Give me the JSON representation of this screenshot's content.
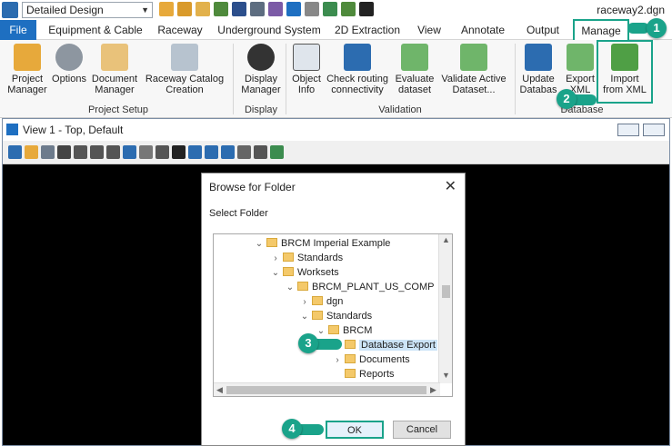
{
  "title_bar": {
    "workspace_select": "Detailed Design",
    "document_title": "raceway2.dgn"
  },
  "tabs": [
    {
      "label": "File"
    },
    {
      "label": "Equipment & Cable"
    },
    {
      "label": "Raceway"
    },
    {
      "label": "Underground System"
    },
    {
      "label": "2D Extraction"
    },
    {
      "label": "View"
    },
    {
      "label": "Annotate"
    },
    {
      "label": "Output"
    },
    {
      "label": "Manage"
    }
  ],
  "ribbon": {
    "project_setup": {
      "label": "Project Setup",
      "project_manager": "Project Manager",
      "options": "Options",
      "document_manager": "Document Manager",
      "raceway_catalog": "Raceway Catalog Creation"
    },
    "display": {
      "label": "Display",
      "display_manager": "Display Manager"
    },
    "validation": {
      "label": "Validation",
      "object_info": "Object Info",
      "check_routing": "Check routing connectivity",
      "evaluate_dataset": "Evaluate dataset",
      "validate_active": "Validate Active Dataset..."
    },
    "database": {
      "label": "Database",
      "update_database": "Update Databas",
      "export_xml": "Export XML",
      "import_xml": "Import from XML"
    }
  },
  "view_window": {
    "title": "View 1 - Top, Default"
  },
  "dialog": {
    "title": "Browse for Folder",
    "subtitle": "Select Folder",
    "tree": [
      {
        "label": "BRCM Imperial Example",
        "expander": "⌄"
      },
      {
        "label": "Standards",
        "expander": "›"
      },
      {
        "label": "Worksets",
        "expander": "⌄"
      },
      {
        "label": "BRCM_PLANT_US_COMP",
        "expander": "⌄"
      },
      {
        "label": "dgn",
        "expander": "›"
      },
      {
        "label": "Standards",
        "expander": "⌄"
      },
      {
        "label": "BRCM",
        "expander": "⌄"
      },
      {
        "label": "Database Export",
        "expander": ""
      },
      {
        "label": "Documents",
        "expander": "›"
      },
      {
        "label": "Reports",
        "expander": ""
      }
    ],
    "ok": "OK",
    "cancel": "Cancel"
  },
  "callouts": [
    "1",
    "2",
    "3",
    "4"
  ],
  "colors": {
    "accent": "#1aa38a",
    "file_tab": "#1e6fc1",
    "folder": "#f4c96a",
    "selection": "#cce4f7"
  }
}
